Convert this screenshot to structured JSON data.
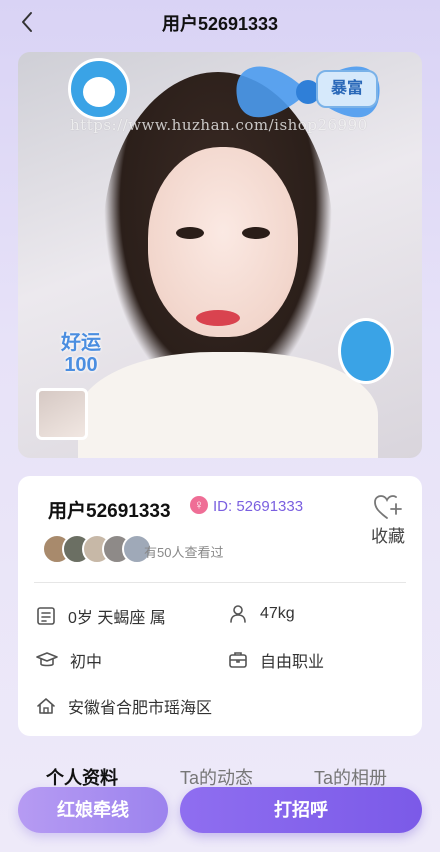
{
  "header": {
    "title": "用户52691333"
  },
  "photo": {
    "watermark": "https://www.huzhan.com/ishop26990",
    "sticker_fortune": "暴富",
    "sticker_luck": "好运100"
  },
  "profile": {
    "name": "用户52691333",
    "gender_icon": "female-symbol",
    "id_text": "ID: 52691333",
    "favorite_label": "收藏",
    "viewed_text": "有50人查看过",
    "age_zodiac": "0岁 天蝎座 属",
    "weight": "47kg",
    "education": "初中",
    "occupation": "自由职业",
    "location": "安徽省合肥市瑶海区"
  },
  "tabs": [
    {
      "label": "个人资料",
      "active": true
    },
    {
      "label": "Ta的动态",
      "active": false
    },
    {
      "label": "Ta的相册",
      "active": false
    }
  ],
  "actions": {
    "match_label": "红娘牵线",
    "greet_label": "打招呼"
  },
  "colors": {
    "accent": "#7b5ae8",
    "id_color": "#7a5fe0",
    "female": "#ef6e96"
  }
}
